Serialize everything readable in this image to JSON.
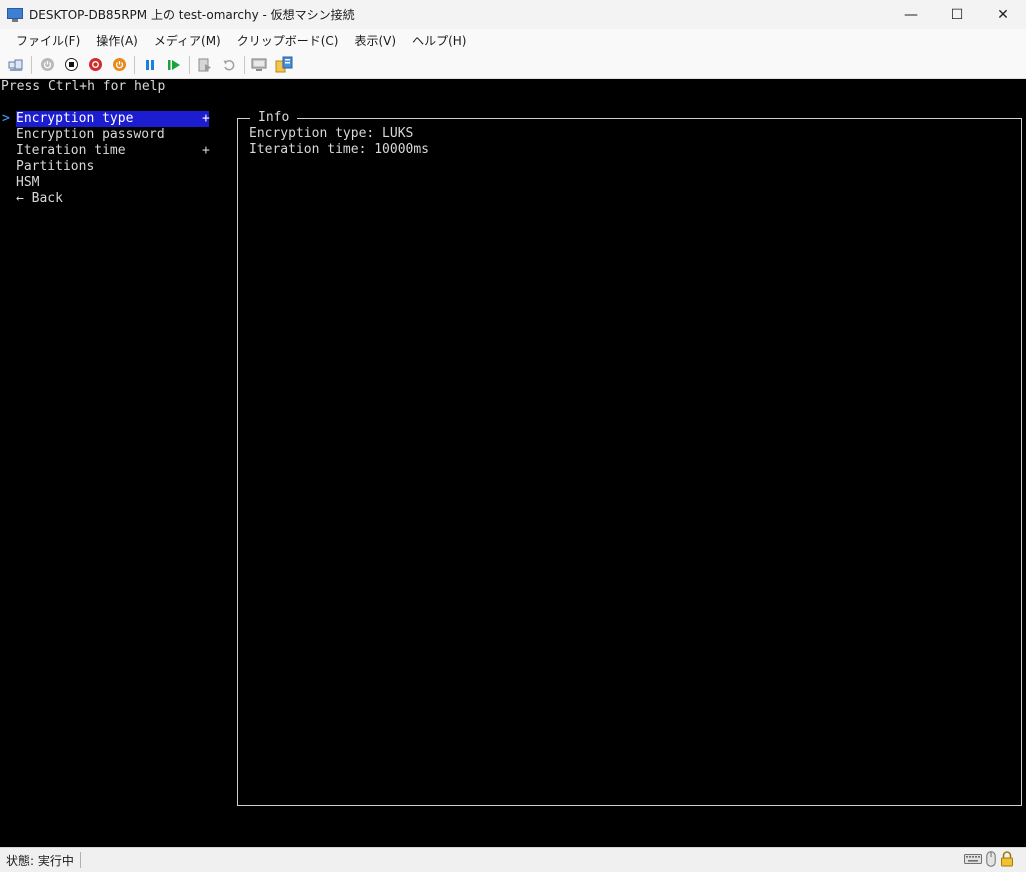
{
  "window": {
    "title": "DESKTOP-DB85RPM 上の test-omarchy - 仮想マシン接続",
    "minimize": "—",
    "maximize": "☐",
    "close": "✕"
  },
  "menubar": {
    "items": [
      {
        "label": "ファイル(F)"
      },
      {
        "label": "操作(A)"
      },
      {
        "label": "メディア(M)"
      },
      {
        "label": "クリップボード(C)"
      },
      {
        "label": "表示(V)"
      },
      {
        "label": "ヘルプ(H)"
      }
    ]
  },
  "toolbar": {
    "icons": [
      "ctrl-alt-del-icon",
      "start-icon",
      "turn-off-icon",
      "shut-down-icon",
      "save-state-icon",
      "pause-icon",
      "resume-icon",
      "checkpoint-icon",
      "revert-icon",
      "enhanced-session-icon",
      "share-icon"
    ],
    "colors": {
      "turn_off": "#d22b2b",
      "shut_down": "#e8891a",
      "pause": "#1e7fe0",
      "resume": "#1aa33a"
    }
  },
  "console": {
    "help_line": "Press Ctrl+h for help",
    "menu": {
      "items": [
        {
          "label": "Encryption type",
          "cursor": ">",
          "marker": "+"
        },
        {
          "label": "Encryption password",
          "cursor": "",
          "marker": ""
        },
        {
          "label": "Iteration time",
          "cursor": "",
          "marker": "+"
        },
        {
          "label": "Partitions",
          "cursor": "",
          "marker": ""
        },
        {
          "label": "HSM",
          "cursor": "",
          "marker": ""
        },
        {
          "label": "← Back",
          "cursor": "",
          "marker": ""
        }
      ]
    },
    "info": {
      "title": "Info",
      "lines": [
        "Encryption type: LUKS",
        "Iteration time: 10000ms"
      ]
    },
    "colors": {
      "selection_bg": "#1c1cd0",
      "cursor": "#4aa3ff",
      "text": "#d8d8d8"
    }
  },
  "statusbar": {
    "status": "状態: 実行中",
    "icons": [
      "keyboard-icon",
      "mouse-icon",
      "lock-icon"
    ]
  }
}
